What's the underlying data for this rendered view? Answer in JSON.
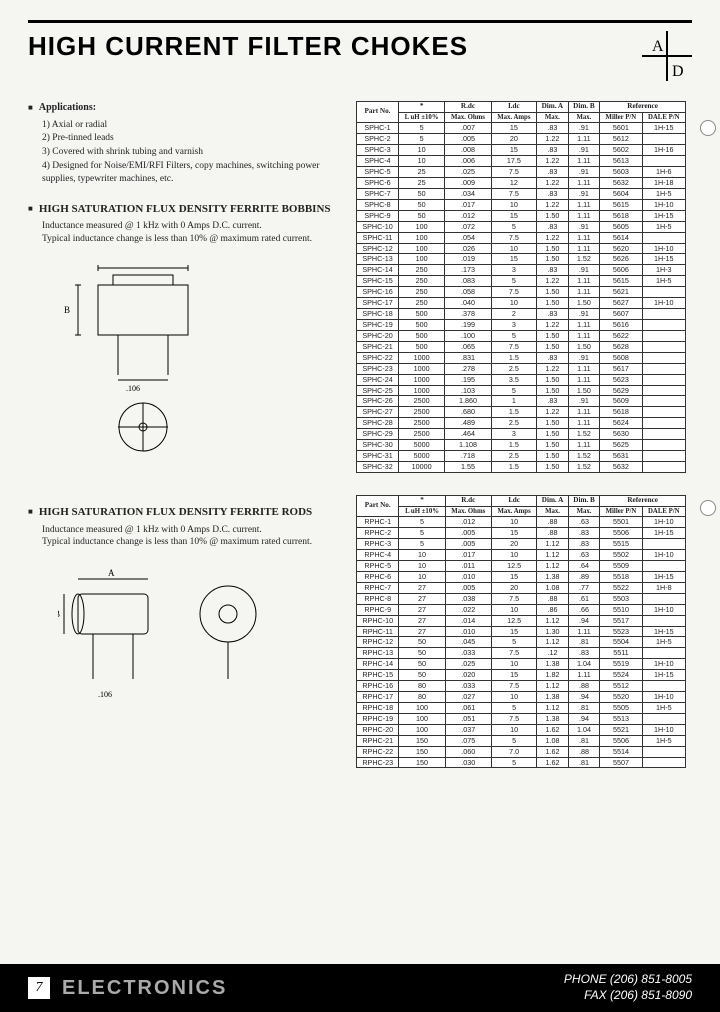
{
  "title": "HIGH CURRENT FILTER CHOKES",
  "logo_letters": {
    "a": "A",
    "d": "D"
  },
  "applications": {
    "heading": "Applications:",
    "items": [
      "1) Axial or radial",
      "2) Pre-tinned leads",
      "3) Covered with shrink tubing and varnish",
      "4) Designed for Noise/EMI/RFI Filters, copy machines, switching power supplies, typewriter machines, etc."
    ]
  },
  "section1": {
    "title": "HIGH SATURATION FLUX DENSITY FERRITE BOBBINS",
    "sub1": "Inductance measured @ 1 kHz with 0 Amps D.C. current.",
    "sub2": "Typical inductance change is less than 10% @ maximum rated current."
  },
  "section2": {
    "title": "HIGH SATURATION FLUX DENSITY FERRITE RODS",
    "sub1": "Inductance measured @ 1 kHz with 0 Amps D.C. current.",
    "sub2": "Typical inductance change is less than 10% @ maximum rated current."
  },
  "dim_labels": {
    "a": "A",
    "b": "B",
    "lead": ".106"
  },
  "table_headers": {
    "part": "Part No.",
    "l": "*",
    "l_sub": "L uH ±10%",
    "rdc": "R.dc",
    "rdc_sub": "Max. Ohms",
    "idc": "I.dc",
    "idc_sub": "Max. Amps",
    "dimA": "Dim. A",
    "dimA_sub": "Max.",
    "dimB": "Dim. B",
    "dimB_sub": "Max.",
    "ref": "Reference",
    "miller": "Miller P/N",
    "dale": "DALE P/N"
  },
  "chart_data": [
    {
      "type": "table",
      "title": "High Saturation Flux Density Ferrite Bobbins",
      "columns": [
        "Part No.",
        "L uH ±10%",
        "R.dc Max. Ohms",
        "I.dc Max. Amps",
        "Dim. A Max.",
        "Dim. B Max.",
        "Miller P/N",
        "DALE P/N"
      ],
      "rows": [
        [
          "SPHC-1",
          "5",
          ".007",
          "15",
          ".83",
          ".91",
          "5601",
          "1H-15"
        ],
        [
          "SPHC-2",
          "5",
          ".005",
          "20",
          "1.22",
          "1.11",
          "5612",
          ""
        ],
        [
          "SPHC-3",
          "10",
          ".008",
          "15",
          ".83",
          ".91",
          "5602",
          "1H-16"
        ],
        [
          "SPHC-4",
          "10",
          ".006",
          "17.5",
          "1.22",
          "1.11",
          "5613",
          ""
        ],
        [
          "SPHC-5",
          "25",
          ".025",
          "7.5",
          ".83",
          ".91",
          "5603",
          "1H-6"
        ],
        [
          "SPHC-6",
          "25",
          ".009",
          "12",
          "1.22",
          "1.11",
          "5632",
          "1H-18"
        ],
        [
          "SPHC-7",
          "50",
          ".034",
          "7.5",
          ".83",
          ".91",
          "5604",
          "1H-5"
        ],
        [
          "SPHC-8",
          "50",
          ".017",
          "10",
          "1.22",
          "1.11",
          "5615",
          "1H-10"
        ],
        [
          "SPHC-9",
          "50",
          ".012",
          "15",
          "1.50",
          "1.11",
          "5618",
          "1H-15"
        ],
        [
          "SPHC-10",
          "100",
          ".072",
          "5",
          ".83",
          ".91",
          "5605",
          "1H-5"
        ],
        [
          "SPHC-11",
          "100",
          ".054",
          "7.5",
          "1.22",
          "1.11",
          "5614",
          ""
        ],
        [
          "SPHC-12",
          "100",
          ".026",
          "10",
          "1.50",
          "1.11",
          "5620",
          "1H-10"
        ],
        [
          "SPHC-13",
          "100",
          ".019",
          "15",
          "1.50",
          "1.52",
          "5626",
          "1H-15"
        ],
        [
          "SPHC-14",
          "250",
          ".173",
          "3",
          ".83",
          ".91",
          "5606",
          "1H-3"
        ],
        [
          "SPHC-15",
          "250",
          ".083",
          "5",
          "1.22",
          "1.11",
          "5615",
          "1H-5"
        ],
        [
          "SPHC-16",
          "250",
          ".058",
          "7.5",
          "1.50",
          "1.11",
          "5621",
          ""
        ],
        [
          "SPHC-17",
          "250",
          ".040",
          "10",
          "1.50",
          "1.50",
          "5627",
          "1H-10"
        ],
        [
          "SPHC-18",
          "500",
          ".378",
          "2",
          ".83",
          ".91",
          "5607",
          ""
        ],
        [
          "SPHC-19",
          "500",
          ".199",
          "3",
          "1.22",
          "1.11",
          "5616",
          ""
        ],
        [
          "SPHC-20",
          "500",
          ".100",
          "5",
          "1.50",
          "1.11",
          "5622",
          ""
        ],
        [
          "SPHC-21",
          "500",
          ".065",
          "7.5",
          "1.50",
          "1.50",
          "5628",
          ""
        ],
        [
          "SPHC-22",
          "1000",
          ".831",
          "1.5",
          ".83",
          ".91",
          "5608",
          ""
        ],
        [
          "SPHC-23",
          "1000",
          ".278",
          "2.5",
          "1.22",
          "1.11",
          "5617",
          ""
        ],
        [
          "SPHC-24",
          "1000",
          ".195",
          "3.5",
          "1.50",
          "1.11",
          "5623",
          ""
        ],
        [
          "SPHC-25",
          "1000",
          ".103",
          "5",
          "1.50",
          "1.50",
          "5629",
          ""
        ],
        [
          "SPHC-26",
          "2500",
          "1.860",
          "1",
          ".83",
          ".91",
          "5609",
          ""
        ],
        [
          "SPHC-27",
          "2500",
          ".680",
          "1.5",
          "1.22",
          "1.11",
          "5618",
          ""
        ],
        [
          "SPHC-28",
          "2500",
          ".489",
          "2.5",
          "1.50",
          "1.11",
          "5624",
          ""
        ],
        [
          "SPHC-29",
          "2500",
          ".464",
          "3",
          "1.50",
          "1.52",
          "5630",
          ""
        ],
        [
          "SPHC-30",
          "5000",
          "1.108",
          "1.5",
          "1.50",
          "1.11",
          "5625",
          ""
        ],
        [
          "SPHC-31",
          "5000",
          ".718",
          "2.5",
          "1.50",
          "1.52",
          "5631",
          ""
        ],
        [
          "SPHC-32",
          "10000",
          "1.55",
          "1.5",
          "1.50",
          "1.52",
          "5632",
          ""
        ]
      ]
    },
    {
      "type": "table",
      "title": "High Saturation Flux Density Ferrite Rods",
      "columns": [
        "Part No.",
        "L uH ±10%",
        "R.dc Max. Ohms",
        "I.dc Max. Amps",
        "Dim. A Max.",
        "Dim. B Max.",
        "Miller P/N",
        "DALE P/N"
      ],
      "rows": [
        [
          "RPHC-1",
          "5",
          ".012",
          "10",
          ".88",
          ".63",
          "5501",
          "1H-10"
        ],
        [
          "RPHC-2",
          "5",
          ".005",
          "15",
          ".88",
          ".83",
          "5506",
          "1H-15"
        ],
        [
          "RPHC-3",
          "5",
          ".005",
          "20",
          "1.12",
          ".83",
          "5515",
          ""
        ],
        [
          "RPHC-4",
          "10",
          ".017",
          "10",
          "1.12",
          ".63",
          "5502",
          "1H-10"
        ],
        [
          "RPHC-5",
          "10",
          ".011",
          "12.5",
          "1.12",
          ".64",
          "5509",
          ""
        ],
        [
          "RPHC-6",
          "10",
          ".010",
          "15",
          "1.38",
          ".89",
          "5518",
          "1H-15"
        ],
        [
          "RPHC-7",
          "27",
          ".005",
          "20",
          "1.08",
          ".77",
          "5522",
          "1H-8"
        ],
        [
          "RPHC-8",
          "27",
          ".038",
          "7.5",
          ".88",
          ".61",
          "5503",
          ""
        ],
        [
          "RPHC-9",
          "27",
          ".022",
          "10",
          ".86",
          ".66",
          "5510",
          "1H-10"
        ],
        [
          "RPHC-10",
          "27",
          ".014",
          "12.5",
          "1.12",
          ".94",
          "5517",
          ""
        ],
        [
          "RPHC-11",
          "27",
          ".010",
          "15",
          "1.30",
          "1.11",
          "5523",
          "1H-15"
        ],
        [
          "RPHC-12",
          "50",
          ".045",
          "5",
          "1.12",
          ".81",
          "5504",
          "1H-5"
        ],
        [
          "RPHC-13",
          "50",
          ".033",
          "7.5",
          ".12",
          ".83",
          "5511",
          ""
        ],
        [
          "RPHC-14",
          "50",
          ".025",
          "10",
          "1.38",
          "1.04",
          "5519",
          "1H-10"
        ],
        [
          "RPHC-15",
          "50",
          ".020",
          "15",
          "1.82",
          "1.11",
          "5524",
          "1H-15"
        ],
        [
          "RPHC-16",
          "80",
          ".033",
          "7.5",
          "1.12",
          ".88",
          "5512",
          ""
        ],
        [
          "RPHC-17",
          "80",
          ".027",
          "10",
          "1.38",
          ".94",
          "5520",
          "1H-10"
        ],
        [
          "RPHC-18",
          "100",
          ".061",
          "5",
          "1.12",
          ".81",
          "5505",
          "1H-5"
        ],
        [
          "RPHC-19",
          "100",
          ".051",
          "7.5",
          "1.38",
          ".94",
          "5513",
          ""
        ],
        [
          "RPHC-20",
          "100",
          ".037",
          "10",
          "1.62",
          "1.04",
          "5521",
          "1H-10"
        ],
        [
          "RPHC-21",
          "150",
          ".075",
          "5",
          "1.08",
          ".81",
          "5506",
          "1H-5"
        ],
        [
          "RPHC-22",
          "150",
          ".060",
          "7.0",
          "1.62",
          ".88",
          "5514",
          ""
        ],
        [
          "RPHC-23",
          "150",
          ".030",
          "5",
          "1.62",
          ".81",
          "5507",
          ""
        ]
      ]
    }
  ],
  "footer": {
    "page": "7",
    "brand": "ELECTRONICS",
    "phone": "PHONE (206) 851-8005",
    "fax": "FAX (206) 851-8090"
  }
}
